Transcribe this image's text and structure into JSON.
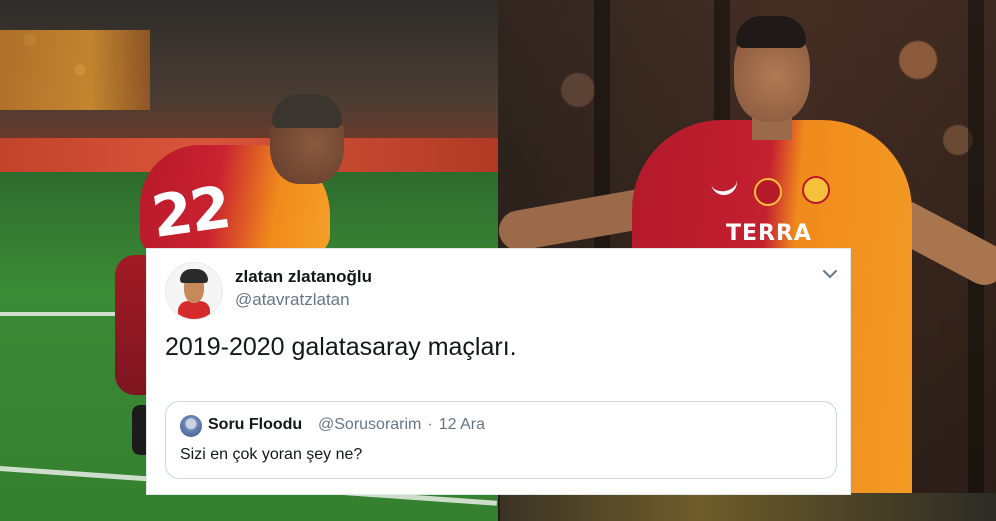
{
  "tweet": {
    "display_name": "zlatan zlatanoğlu",
    "handle": "@atavratzlatan",
    "text": "2019-2020 galatasaray maçları.",
    "menu_icon": "chevron-down-icon"
  },
  "quoted_tweet": {
    "display_name": "Soru Floodu",
    "handle": "@Sorusorarim",
    "separator": "·",
    "date": "12 Ara",
    "text": "Sizi en çok yoran şey ne?"
  },
  "photos": {
    "left": {
      "jersey_number": "22"
    },
    "right": {
      "sponsor_text": "TERRA"
    }
  },
  "colors": {
    "twitter_text": "#14171a",
    "twitter_secondary": "#657786",
    "twitter_border": "#ccd6dd",
    "galatasaray_red": "#b8192a",
    "galatasaray_orange": "#f08a1c"
  }
}
